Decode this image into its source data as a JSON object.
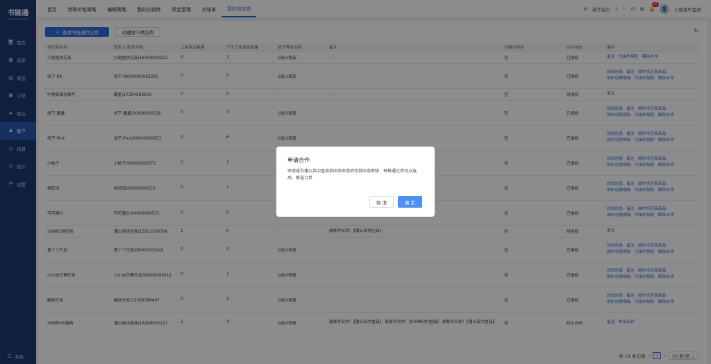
{
  "sidebar": {
    "logo": "书链通",
    "logo_sub": "BOOK LINK TONG",
    "items": [
      {
        "icon": "🖥",
        "label": "首页"
      },
      {
        "icon": "▦",
        "label": "选品"
      },
      {
        "icon": "▤",
        "label": "商品"
      },
      {
        "icon": "▣",
        "label": "订单"
      },
      {
        "icon": "◈",
        "label": "售后"
      },
      {
        "icon": "♟",
        "label": "客户"
      },
      {
        "icon": "◎",
        "label": "结算"
      },
      {
        "icon": "◷",
        "label": "统计"
      },
      {
        "icon": "☰",
        "label": "设置"
      }
    ],
    "collapse": "收缩"
  },
  "topbar": {
    "tabs": [
      "首页",
      "特殊价格策略",
      "编辑策略",
      "我的分销商",
      "资金管理",
      "对账单",
      "我的供应商"
    ],
    "guide": "新手指引",
    "badge": "10",
    "user": "小尾鱼中盘商"
  },
  "toolbar": {
    "invite": "邀请书链通供应商",
    "create": "创建线下供应商"
  },
  "table": {
    "headers": [
      "供应商名称",
      "联系人/联系手机",
      "上架商品数量",
      "产生订单商品数量",
      "赋予等级名称",
      "备注",
      "代操作授权",
      "合作状态",
      "操作"
    ],
    "rows": [
      {
        "name": "小尾鱼供应商",
        "contact": "小尾鱼供应商/18300002222",
        "listed": "0",
        "ordered": "1",
        "level": "1级分销商",
        "note": "-",
        "auth": "否",
        "status": "已授权",
        "ops": [
          "备注",
          "代操作授权",
          "解除合作"
        ]
      },
      {
        "name": "线下-KK",
        "contact": "线下-KK/00000002260",
        "listed": "0",
        "ordered": "0",
        "level": "1级分销商",
        "note": "-",
        "auth": "否",
        "status": "已授权",
        "ops": [
          "修改信息",
          "备注",
          "维护供应商商品",
          "维护运费模板",
          "代操作授权",
          "解除合作"
        ]
      },
      {
        "name": "中盘商体验账号",
        "contact": "嘉星/17364683643",
        "listed": "0",
        "ordered": "0",
        "level": "-",
        "note": "-",
        "auth": "否",
        "status": "待授权",
        "ops": [
          "备注"
        ]
      },
      {
        "name": "线下-嘉嘉",
        "contact": "线下-嘉嘉/00000000726",
        "listed": "0",
        "ordered": "0",
        "level": "1级分销商",
        "note": "-",
        "auth": "否",
        "status": "已授权",
        "ops": [
          "修改信息",
          "备注",
          "维护供应商商品",
          "维护运费模板",
          "代操作授权",
          "解除合作"
        ]
      },
      {
        "name": "线下-Pink",
        "contact": "线下-Pink/00000000657",
        "listed": "0",
        "ordered": "6",
        "level": "1级分销商",
        "note": "-",
        "auth": "否",
        "status": "已授权",
        "ops": [
          "修改信息",
          "备注",
          "维护供应商商品",
          "维护运费模板",
          "代操作授权",
          "解除合作"
        ]
      },
      {
        "name": "小桃子",
        "contact": "小桃子/00000000573",
        "listed": "0",
        "ordered": "1",
        "level": "1级分销商",
        "note": "-",
        "auth": "否",
        "status": "已授权",
        "ops": [
          "修改信息",
          "备注",
          "维护供应商商品",
          "维护运费模板",
          "代操作授权",
          "解除合作"
        ]
      },
      {
        "name": "桃花坞",
        "contact": "桃花坞/00000000572",
        "listed": "0",
        "ordered": "1",
        "level": "1级分销商",
        "note": "-",
        "auth": "否",
        "status": "已授权",
        "ops": [
          "修改信息",
          "备注",
          "维护供应商商品",
          "维护运费模板",
          "代操作授权",
          "解除合作"
        ]
      },
      {
        "name": "可可满分",
        "contact": "可可满分/00000000571",
        "listed": "0",
        "ordered": "0",
        "level": "1级分销商",
        "note": "-",
        "auth": "否",
        "status": "已授权",
        "ops": [
          "修改信息",
          "备注",
          "维护供应商商品",
          "维护运费模板",
          "代操作授权",
          "解除合作"
        ]
      },
      {
        "name": "SHIMEI供应商",
        "contact": "蒲公英供应商/15912500796",
        "listed": "1",
        "ordered": "0",
        "level": "-",
        "note": "原账号名称：【蒲公英供应商】",
        "auth": "否",
        "status": "待授权",
        "ops": [
          "备注"
        ]
      },
      {
        "name": "黄丫丫代发",
        "contact": "黄丫丫代发/00000000245",
        "listed": "0",
        "ordered": "0",
        "level": "1级分销商",
        "note": "-",
        "auth": "否",
        "status": "已授权",
        "ops": [
          "修改信息",
          "备注",
          "维护供应商商品",
          "维护运费模板",
          "代操作授权",
          "解除合作"
        ]
      },
      {
        "name": "小小向日葵代发",
        "contact": "小小向日葵代发/00000000212",
        "listed": "0",
        "ordered": "1",
        "level": "1级分销商",
        "note": "-",
        "auth": "否",
        "status": "已授权",
        "ops": [
          "修改信息",
          "备注",
          "维护供应商商品",
          "维护运费模板",
          "代操作授权",
          "解除合作"
        ]
      },
      {
        "name": "解放代发",
        "contact": "解放代发/12358796487",
        "listed": "0",
        "ordered": "2",
        "level": "1级分销商",
        "note": "-",
        "auth": "否",
        "status": "已授权",
        "ops": [
          "修改信息",
          "备注",
          "维护供应商商品",
          "维护运费模板",
          "代操作授权",
          "解除合作"
        ]
      },
      {
        "name": "SHIMEI中盘商",
        "contact": "蒲公英中盘商/18208925121",
        "listed": "2",
        "ordered": "4",
        "level": "1级分销商",
        "note": "原账号名称：【蒲公英中盘商】 原账号名称：【SHIMEI中盘商】 原账号名称：【蒲公英中盘商】",
        "auth": "否",
        "status": "终止合作",
        "ops": [
          "备注",
          "申请合作"
        ]
      }
    ]
  },
  "pagination": {
    "total": "共 14 条记录",
    "current": "1",
    "page_size": "20 条/页"
  },
  "modal": {
    "title": "申请合作",
    "body": "申请成为蒲公英中盘商供应商申请后待供应商审核，审核通过将可以选品、推送订单",
    "cancel": "取 消",
    "ok": "确 定"
  }
}
